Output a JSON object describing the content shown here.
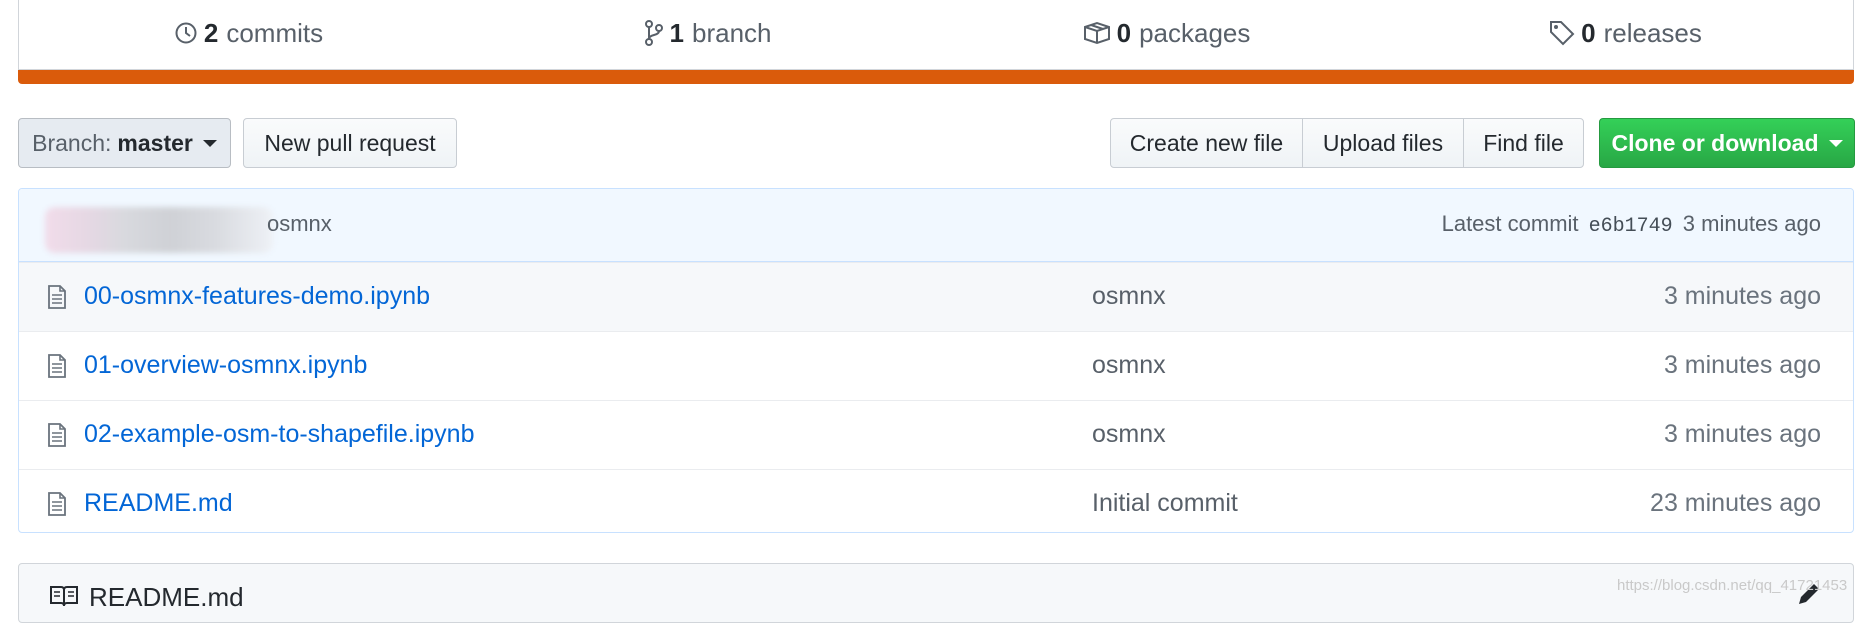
{
  "stats": {
    "commits": {
      "count": "2",
      "label": "commits",
      "icon": "history-icon"
    },
    "branches": {
      "count": "1",
      "label": "branch",
      "icon": "git-branch-icon"
    },
    "packages": {
      "count": "0",
      "label": "packages",
      "icon": "package-icon"
    },
    "releases": {
      "count": "0",
      "label": "releases",
      "icon": "tag-icon"
    }
  },
  "language_bar_color": "#da5b0b",
  "toolbar": {
    "branch_label": "Branch:",
    "branch_value": "master",
    "new_pr": "New pull request",
    "create_file": "Create new file",
    "upload_files": "Upload files",
    "find_file": "Find file",
    "clone": "Clone or download"
  },
  "commit_tease": {
    "author": "osmnx",
    "latest_label": "Latest commit",
    "sha": "e6b1749",
    "age": "3 minutes ago"
  },
  "files": [
    {
      "name": "00-osmnx-features-demo.ipynb",
      "message": "osmnx",
      "age": "3 minutes ago"
    },
    {
      "name": "01-overview-osmnx.ipynb",
      "message": "osmnx",
      "age": "3 minutes ago"
    },
    {
      "name": "02-example-osm-to-shapefile.ipynb",
      "message": "osmnx",
      "age": "3 minutes ago"
    },
    {
      "name": "README.md",
      "message": "Initial commit",
      "age": "23 minutes ago"
    }
  ],
  "readme": {
    "title": "README.md"
  },
  "watermark": "https://blog.csdn.net/qq_41721453",
  "colors": {
    "accent_green": "#28a745",
    "link_blue": "#0366d6"
  }
}
